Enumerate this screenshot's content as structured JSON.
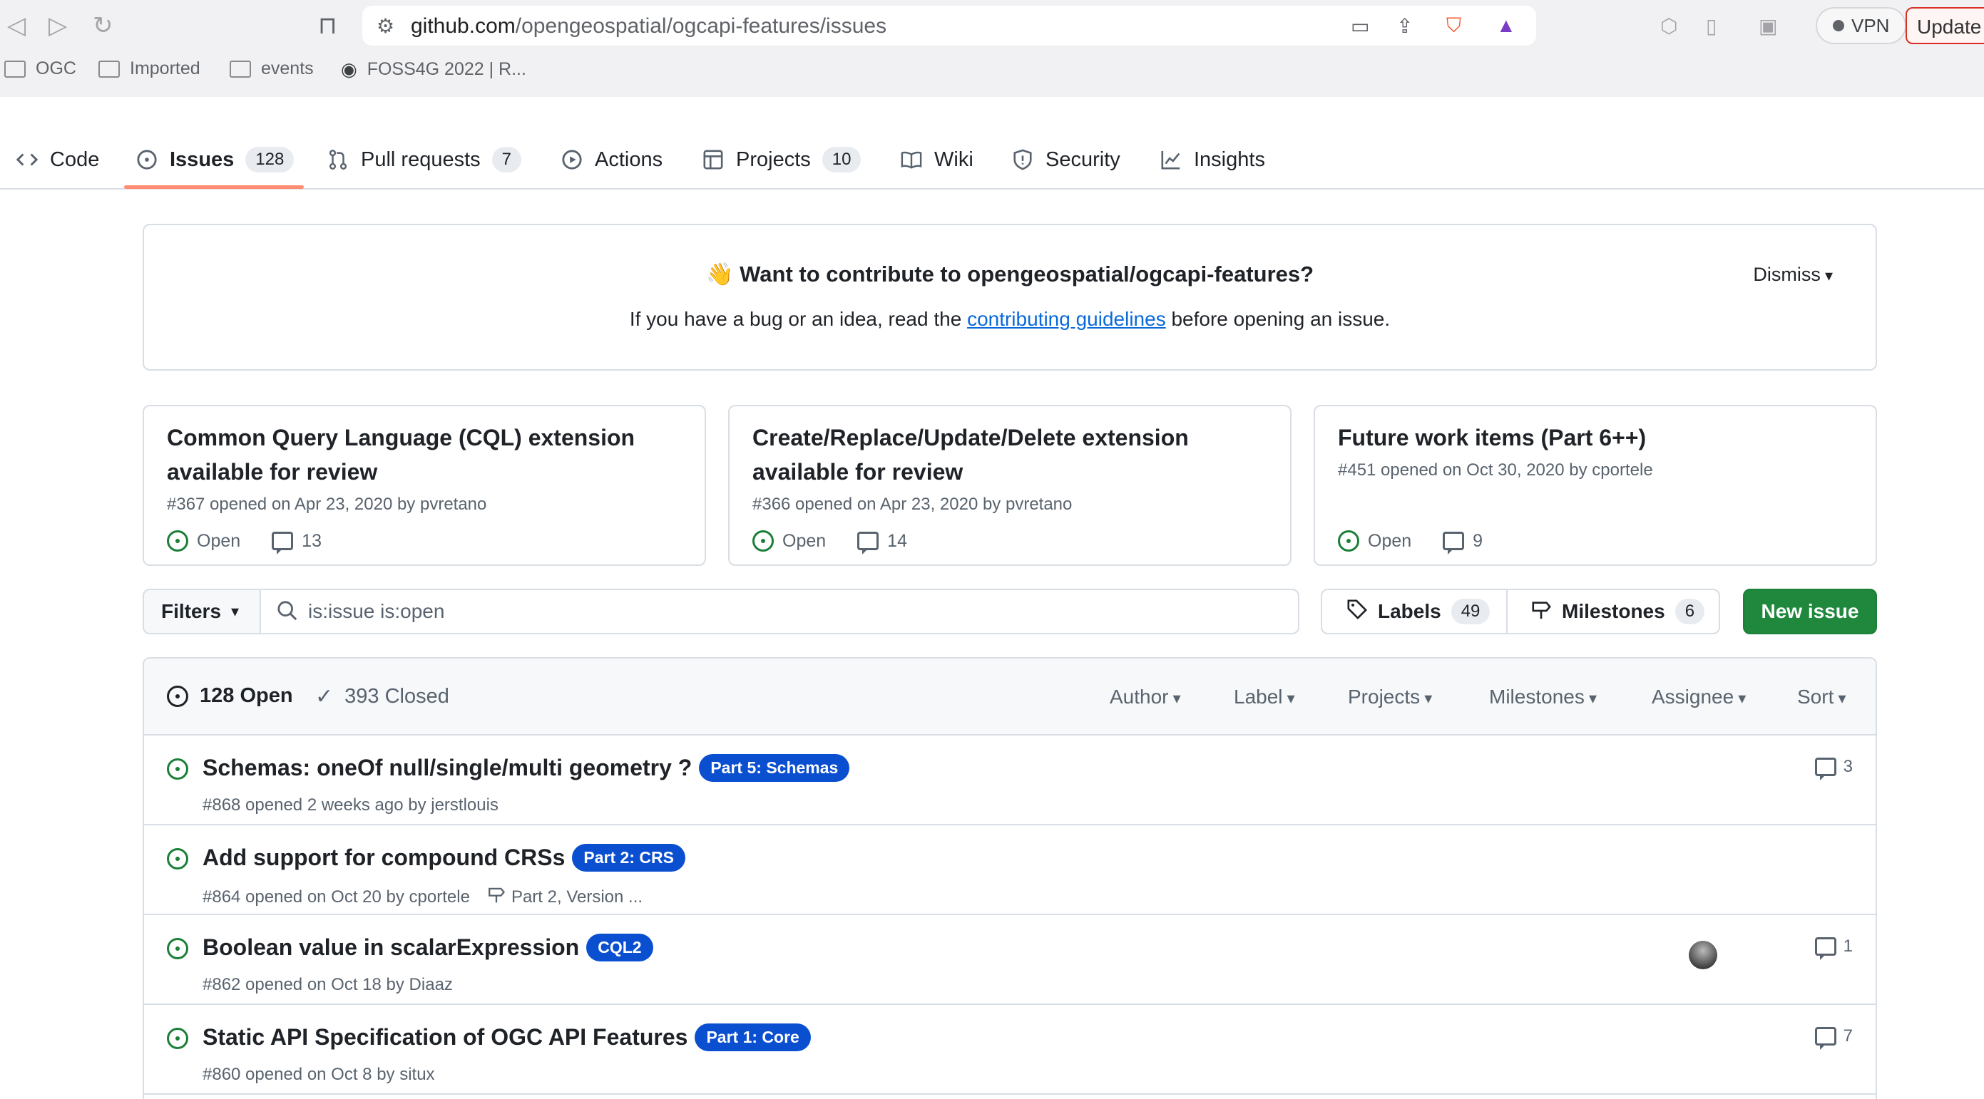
{
  "browser": {
    "url_host": "github.com",
    "url_path": "/opengeospatial/ogcapi-features/issues",
    "bookmarks": [
      "OGC",
      "Imported",
      "events",
      "FOSS4G 2022 | R..."
    ],
    "vpn_label": "VPN",
    "update_label": "Update"
  },
  "repo_nav": {
    "tabs": [
      {
        "label": "Code",
        "count": ""
      },
      {
        "label": "Issues",
        "count": "128"
      },
      {
        "label": "Pull requests",
        "count": "7"
      },
      {
        "label": "Actions",
        "count": ""
      },
      {
        "label": "Projects",
        "count": "10"
      },
      {
        "label": "Wiki",
        "count": ""
      },
      {
        "label": "Security",
        "count": ""
      },
      {
        "label": "Insights",
        "count": ""
      }
    ]
  },
  "banner": {
    "emoji": "👋",
    "title": "Want to contribute to opengeospatial/ogcapi-features?",
    "text_before": "If you have a bug or an idea, read the ",
    "link": "contributing guidelines",
    "text_after": " before opening an issue.",
    "dismiss": "Dismiss"
  },
  "pinned": [
    {
      "title": "Common Query Language (CQL) extension available for review",
      "meta": "#367 opened on Apr 23, 2020 by pvretano",
      "state": "Open",
      "comments": "13"
    },
    {
      "title": "Create/Replace/Update/Delete extension available for review",
      "meta": "#366 opened on Apr 23, 2020 by pvretano",
      "state": "Open",
      "comments": "14"
    },
    {
      "title": "Future work items (Part 6++)",
      "meta": "#451 opened on Oct 30, 2020 by cportele",
      "state": "Open",
      "comments": "9"
    }
  ],
  "filter": {
    "filters_label": "Filters",
    "query": "is:issue is:open",
    "labels_label": "Labels",
    "labels_count": "49",
    "milestones_label": "Milestones",
    "milestones_count": "6",
    "new_issue": "New issue"
  },
  "list_header": {
    "open": "128 Open",
    "closed": "393 Closed",
    "menus": [
      "Author",
      "Label",
      "Projects",
      "Milestones",
      "Assignee",
      "Sort"
    ]
  },
  "issues": [
    {
      "title": "Schemas: oneOf null/single/multi geometry ?",
      "label": "Part 5: Schemas",
      "meta": "#868 opened 2 weeks ago by jerstlouis",
      "milestone": "",
      "comments": "3"
    },
    {
      "title": "Add support for compound CRSs",
      "label": "Part 2: CRS",
      "meta": "#864 opened on Oct 20 by cportele",
      "milestone": "Part 2, Version ...",
      "comments": ""
    },
    {
      "title": "Boolean value in scalarExpression",
      "label": "CQL2",
      "meta": "#862 opened on Oct 18 by Diaaz",
      "milestone": "",
      "comments": "1"
    },
    {
      "title": "Static API Specification of OGC API Features",
      "label": "Part 1: Core",
      "meta": "#860 opened on Oct 8 by situx",
      "milestone": "",
      "comments": "7"
    }
  ],
  "colors": {
    "accent_green": "#1f883d",
    "label_blue": "#0b4fd1",
    "tab_underline": "#fd8c73",
    "link": "#0969da"
  }
}
